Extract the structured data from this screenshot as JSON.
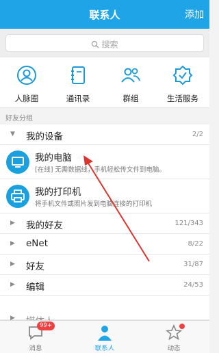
{
  "header": {
    "title": "联系人",
    "add_label": "添加"
  },
  "search": {
    "placeholder": "搜索"
  },
  "quick_actions": [
    {
      "label": "人脉圈",
      "icon": "person-circle-icon"
    },
    {
      "label": "通讯录",
      "icon": "address-book-icon"
    },
    {
      "label": "群组",
      "icon": "group-icon"
    },
    {
      "label": "生活服务",
      "icon": "service-badge-icon"
    }
  ],
  "section_label": "好友分组",
  "groups": {
    "my_devices": {
      "name": "我的设备",
      "count": "2/2"
    },
    "my_friends": {
      "name": "我的好友",
      "count": "121/343"
    },
    "enet": {
      "name": "eNet",
      "count": "8/22"
    },
    "friends": {
      "name": "好友",
      "count": "31/87"
    },
    "editor": {
      "name": "编辑",
      "count": "24/53"
    },
    "partial": {
      "name": "媒体人"
    }
  },
  "devices": {
    "computer": {
      "name": "我的电脑",
      "desc": "[在线] 无需数据线，手机轻松传文件到电脑。"
    },
    "printer": {
      "name": "我的打印机",
      "desc": "将手机文件或照片发到电脑连接的打印机"
    }
  },
  "tabbar": {
    "messages": {
      "label": "消息",
      "badge": "99+"
    },
    "contacts": {
      "label": "联系人"
    },
    "dynamics": {
      "label": "动态"
    }
  },
  "colors": {
    "accent": "#1fa5e7",
    "badge": "#f04040",
    "arrow_annotation": "#d9362e"
  }
}
